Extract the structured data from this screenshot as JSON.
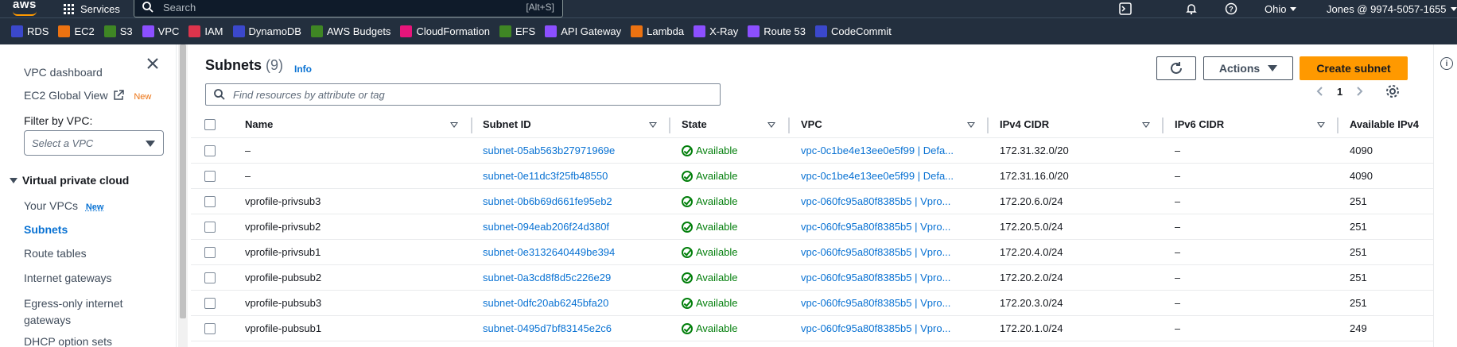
{
  "topnav": {
    "logo": "aws",
    "services_label": "Services",
    "search_placeholder": "Search",
    "search_shortcut": "[Alt+S]",
    "region": "Ohio",
    "account": "Jones @ 9974-5057-1655"
  },
  "favorites": [
    {
      "label": "RDS",
      "color": "#3b48cc",
      "icon": "rds-icon"
    },
    {
      "label": "EC2",
      "color": "#ec7211",
      "icon": "ec2-icon"
    },
    {
      "label": "S3",
      "color": "#3f8624",
      "icon": "s3-icon"
    },
    {
      "label": "VPC",
      "color": "#8c4fff",
      "icon": "vpc-icon"
    },
    {
      "label": "IAM",
      "color": "#dd344c",
      "icon": "iam-icon"
    },
    {
      "label": "DynamoDB",
      "color": "#3b48cc",
      "icon": "dynamodb-icon"
    },
    {
      "label": "AWS Budgets",
      "color": "#3f8624",
      "icon": "budgets-icon"
    },
    {
      "label": "CloudFormation",
      "color": "#e7157b",
      "icon": "cloudformation-icon"
    },
    {
      "label": "EFS",
      "color": "#3f8624",
      "icon": "efs-icon"
    },
    {
      "label": "API Gateway",
      "color": "#8c4fff",
      "icon": "api-gateway-icon"
    },
    {
      "label": "Lambda",
      "color": "#ec7211",
      "icon": "lambda-icon"
    },
    {
      "label": "X-Ray",
      "color": "#8c4fff",
      "icon": "xray-icon"
    },
    {
      "label": "Route 53",
      "color": "#8c4fff",
      "icon": "route53-icon"
    },
    {
      "label": "CodeCommit",
      "color": "#3b48cc",
      "icon": "codecommit-icon"
    }
  ],
  "sidebar": {
    "dashboard": "VPC dashboard",
    "global_view": "EC2 Global View",
    "global_view_badge": "New",
    "filter_label": "Filter by VPC:",
    "filter_placeholder": "Select a VPC",
    "section": "Virtual private cloud",
    "items": [
      {
        "label": "Your VPCs",
        "badge": "New"
      },
      {
        "label": "Subnets"
      },
      {
        "label": "Route tables"
      },
      {
        "label": "Internet gateways"
      },
      {
        "label": "Egress-only internet gateways"
      },
      {
        "label": "DHCP option sets"
      }
    ]
  },
  "main": {
    "title": "Subnets",
    "count": "(9)",
    "info": "Info",
    "actions": "Actions",
    "create": "Create subnet",
    "filter_placeholder": "Find resources by attribute or tag",
    "page": "1"
  },
  "table": {
    "columns": [
      "Name",
      "Subnet ID",
      "State",
      "VPC",
      "IPv4 CIDR",
      "IPv6 CIDR",
      "Available IPv4"
    ],
    "rows": [
      {
        "name": "–",
        "subnet_id": "subnet-05ab563b27971969e",
        "state": "Available",
        "vpc": "vpc-0c1be4e13ee0e5f99 | Defa...",
        "ipv4": "172.31.32.0/20",
        "ipv6": "–",
        "avail": "4090"
      },
      {
        "name": "–",
        "subnet_id": "subnet-0e11dc3f25fb48550",
        "state": "Available",
        "vpc": "vpc-0c1be4e13ee0e5f99 | Defa...",
        "ipv4": "172.31.16.0/20",
        "ipv6": "–",
        "avail": "4090"
      },
      {
        "name": "vprofile-privsub3",
        "subnet_id": "subnet-0b6b69d661fe95eb2",
        "state": "Available",
        "vpc": "vpc-060fc95a80f8385b5 | Vpro...",
        "ipv4": "172.20.6.0/24",
        "ipv6": "–",
        "avail": "251"
      },
      {
        "name": "vprofile-privsub2",
        "subnet_id": "subnet-094eab206f24d380f",
        "state": "Available",
        "vpc": "vpc-060fc95a80f8385b5 | Vpro...",
        "ipv4": "172.20.5.0/24",
        "ipv6": "–",
        "avail": "251"
      },
      {
        "name": "vprofile-privsub1",
        "subnet_id": "subnet-0e3132640449be394",
        "state": "Available",
        "vpc": "vpc-060fc95a80f8385b5 | Vpro...",
        "ipv4": "172.20.4.0/24",
        "ipv6": "–",
        "avail": "251"
      },
      {
        "name": "vprofile-pubsub2",
        "subnet_id": "subnet-0a3cd8f8d5c226e29",
        "state": "Available",
        "vpc": "vpc-060fc95a80f8385b5 | Vpro...",
        "ipv4": "172.20.2.0/24",
        "ipv6": "–",
        "avail": "251"
      },
      {
        "name": "vprofile-pubsub3",
        "subnet_id": "subnet-0dfc20ab6245bfa20",
        "state": "Available",
        "vpc": "vpc-060fc95a80f8385b5 | Vpro...",
        "ipv4": "172.20.3.0/24",
        "ipv6": "–",
        "avail": "251"
      },
      {
        "name": "vprofile-pubsub1",
        "subnet_id": "subnet-0495d7bf83145e2c6",
        "state": "Available",
        "vpc": "vpc-060fc95a80f8385b5 | Vpro...",
        "ipv4": "172.20.1.0/24",
        "ipv6": "–",
        "avail": "249"
      }
    ]
  }
}
